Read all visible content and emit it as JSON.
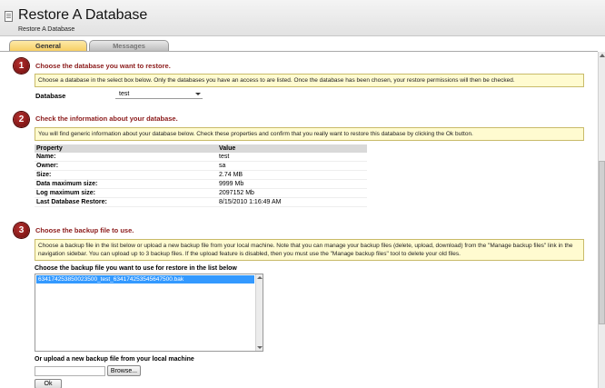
{
  "window": {
    "title": "Restore A Database",
    "breadcrumb": "Restore A Database"
  },
  "tabs": [
    {
      "label": "General",
      "active": true
    },
    {
      "label": "Messages",
      "active": false
    }
  ],
  "steps": [
    {
      "number": "1",
      "title": "Choose the database you want to restore.",
      "info": "Choose a database in the select box below. Only the databases you have an access to are listed. Once the database has been chosen, your restore permissions will then be checked."
    },
    {
      "number": "2",
      "title": "Check the information about your database.",
      "info": "You will find generic information about your database below. Check these properties and confirm that you really want to restore this database by clicking the Ok button."
    },
    {
      "number": "3",
      "title": "Choose the backup file to use.",
      "info": "Choose a backup file in the list below or upload a new backup file from your local machine. Note that you can manage your backup files (delete, upload, download) from the \"Manage backup files\" link in the navigation sidebar. You can upload up to 3 backup files. If the upload feature is disabled, then you must use the \"Manage backup files\" tool to delete your old files."
    }
  ],
  "database": {
    "label": "Database",
    "selected": "test"
  },
  "properties": {
    "headers": [
      "Property",
      "Value"
    ],
    "rows": [
      [
        "Name:",
        "test"
      ],
      [
        "Owner:",
        "sa"
      ],
      [
        "Size:",
        "2.74 MB"
      ],
      [
        "Data maximum size:",
        "9999 Mb"
      ],
      [
        "Log maximum size:",
        "2097152 Mb"
      ],
      [
        "Last Database Restore:",
        "8/15/2010 1:16:49 AM"
      ]
    ]
  },
  "backup": {
    "list_label": "Choose the backup file you want to use for restore in the list below",
    "files": [
      "634174253850023500_test_634174253545647500.bak"
    ],
    "upload_label": "Or upload a new backup file from your local machine",
    "browse_label": "Browse...",
    "ok_label": "Ok"
  },
  "colors": {
    "accent": "#8b1a1a",
    "info_bg": "#fffbd0",
    "tab_active": "#f7cf65",
    "selection": "#3399ff"
  }
}
